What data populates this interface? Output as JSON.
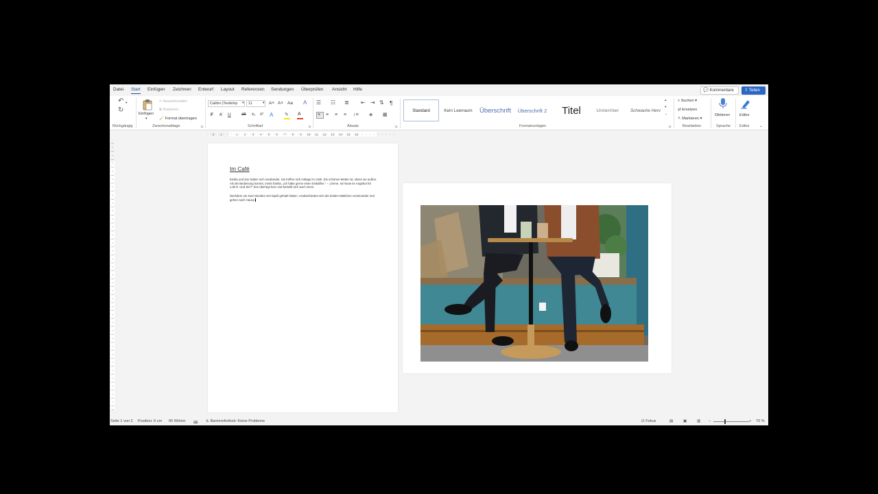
{
  "menu": {
    "tabs": [
      "Datei",
      "Start",
      "Einfügen",
      "Zeichnen",
      "Entwurf",
      "Layout",
      "Referenzen",
      "Sendungen",
      "Überprüfen",
      "Ansicht",
      "Hilfe"
    ],
    "active_tab": "Start",
    "comments_label": "Kommentare",
    "share_label": "Teilen"
  },
  "ribbon": {
    "undo": {
      "label": "Rückgängig"
    },
    "clipboard": {
      "label": "Zwischenablage",
      "paste": "Einfügen",
      "cut": "Ausschneiden",
      "copy": "Kopieren",
      "format_painter": "Format übertragen"
    },
    "font": {
      "label": "Schriftart",
      "font_name": "Calibri (Textkörp",
      "font_size": "11",
      "bold": "F",
      "italic": "K",
      "underline": "U",
      "strike": "ab",
      "sub": "x₂",
      "sup": "x²",
      "grow": "A˄",
      "shrink": "A˅",
      "case": "Aa",
      "clear": "A",
      "effects": "A",
      "font_color": "A"
    },
    "paragraph": {
      "label": "Absatz",
      "marks": "¶"
    },
    "styles": {
      "label": "Formatvorlagen",
      "items": [
        "Standard",
        "Kein Leerraum",
        "Überschrift",
        "Überschrift 2",
        "Titel",
        "Untertitel",
        "Schwache Herv"
      ]
    },
    "editing": {
      "label": "Bearbeiten",
      "find": "Suchen",
      "replace": "Ersetzen",
      "select": "Markieren"
    },
    "voice": {
      "label": "Sprache",
      "dictate": "Diktieren"
    },
    "editor": {
      "label": "Editor",
      "button": "Editor"
    }
  },
  "ruler": {
    "marks": [
      "3",
      "2",
      "1",
      "1",
      "2",
      "3",
      "4",
      "5",
      "6",
      "7",
      "8",
      "9",
      "10",
      "11",
      "12",
      "13",
      "14",
      "15",
      "16"
    ]
  },
  "document": {
    "title": "Im Café",
    "para1": "Emilia und Zoe haben sich verabredet. Sie treffen sich mittags im Café. Die schönes Wetter ist, sitzen sie außen. Als die Bedienung kommt, meint Emilia: „Ich hätte gerne einen Eiskaffee.“ – „Gerne. Ist heute im Angebot für 1,50 €. Und Sie?“ Zoe überlegt kurz und bestellt sich auch einen.",
    "para2": "Nachdem sie zwei Stunden viel Spaß gehabt haben, verabschieden sich die beiden Mädchen voneinander und gehen nach Hause."
  },
  "statusbar": {
    "page": "Seite 1 von 2",
    "position": "Position: 6 cm",
    "words": "66 Wörter",
    "accessibility": "Barrierefreiheit: Keine Probleme",
    "focus": "Fokus",
    "zoom": "70 %"
  },
  "colors": {
    "accent": "#2b66c4",
    "font_color_bar": "#e03c31",
    "highlight_bar": "#f7e600"
  }
}
